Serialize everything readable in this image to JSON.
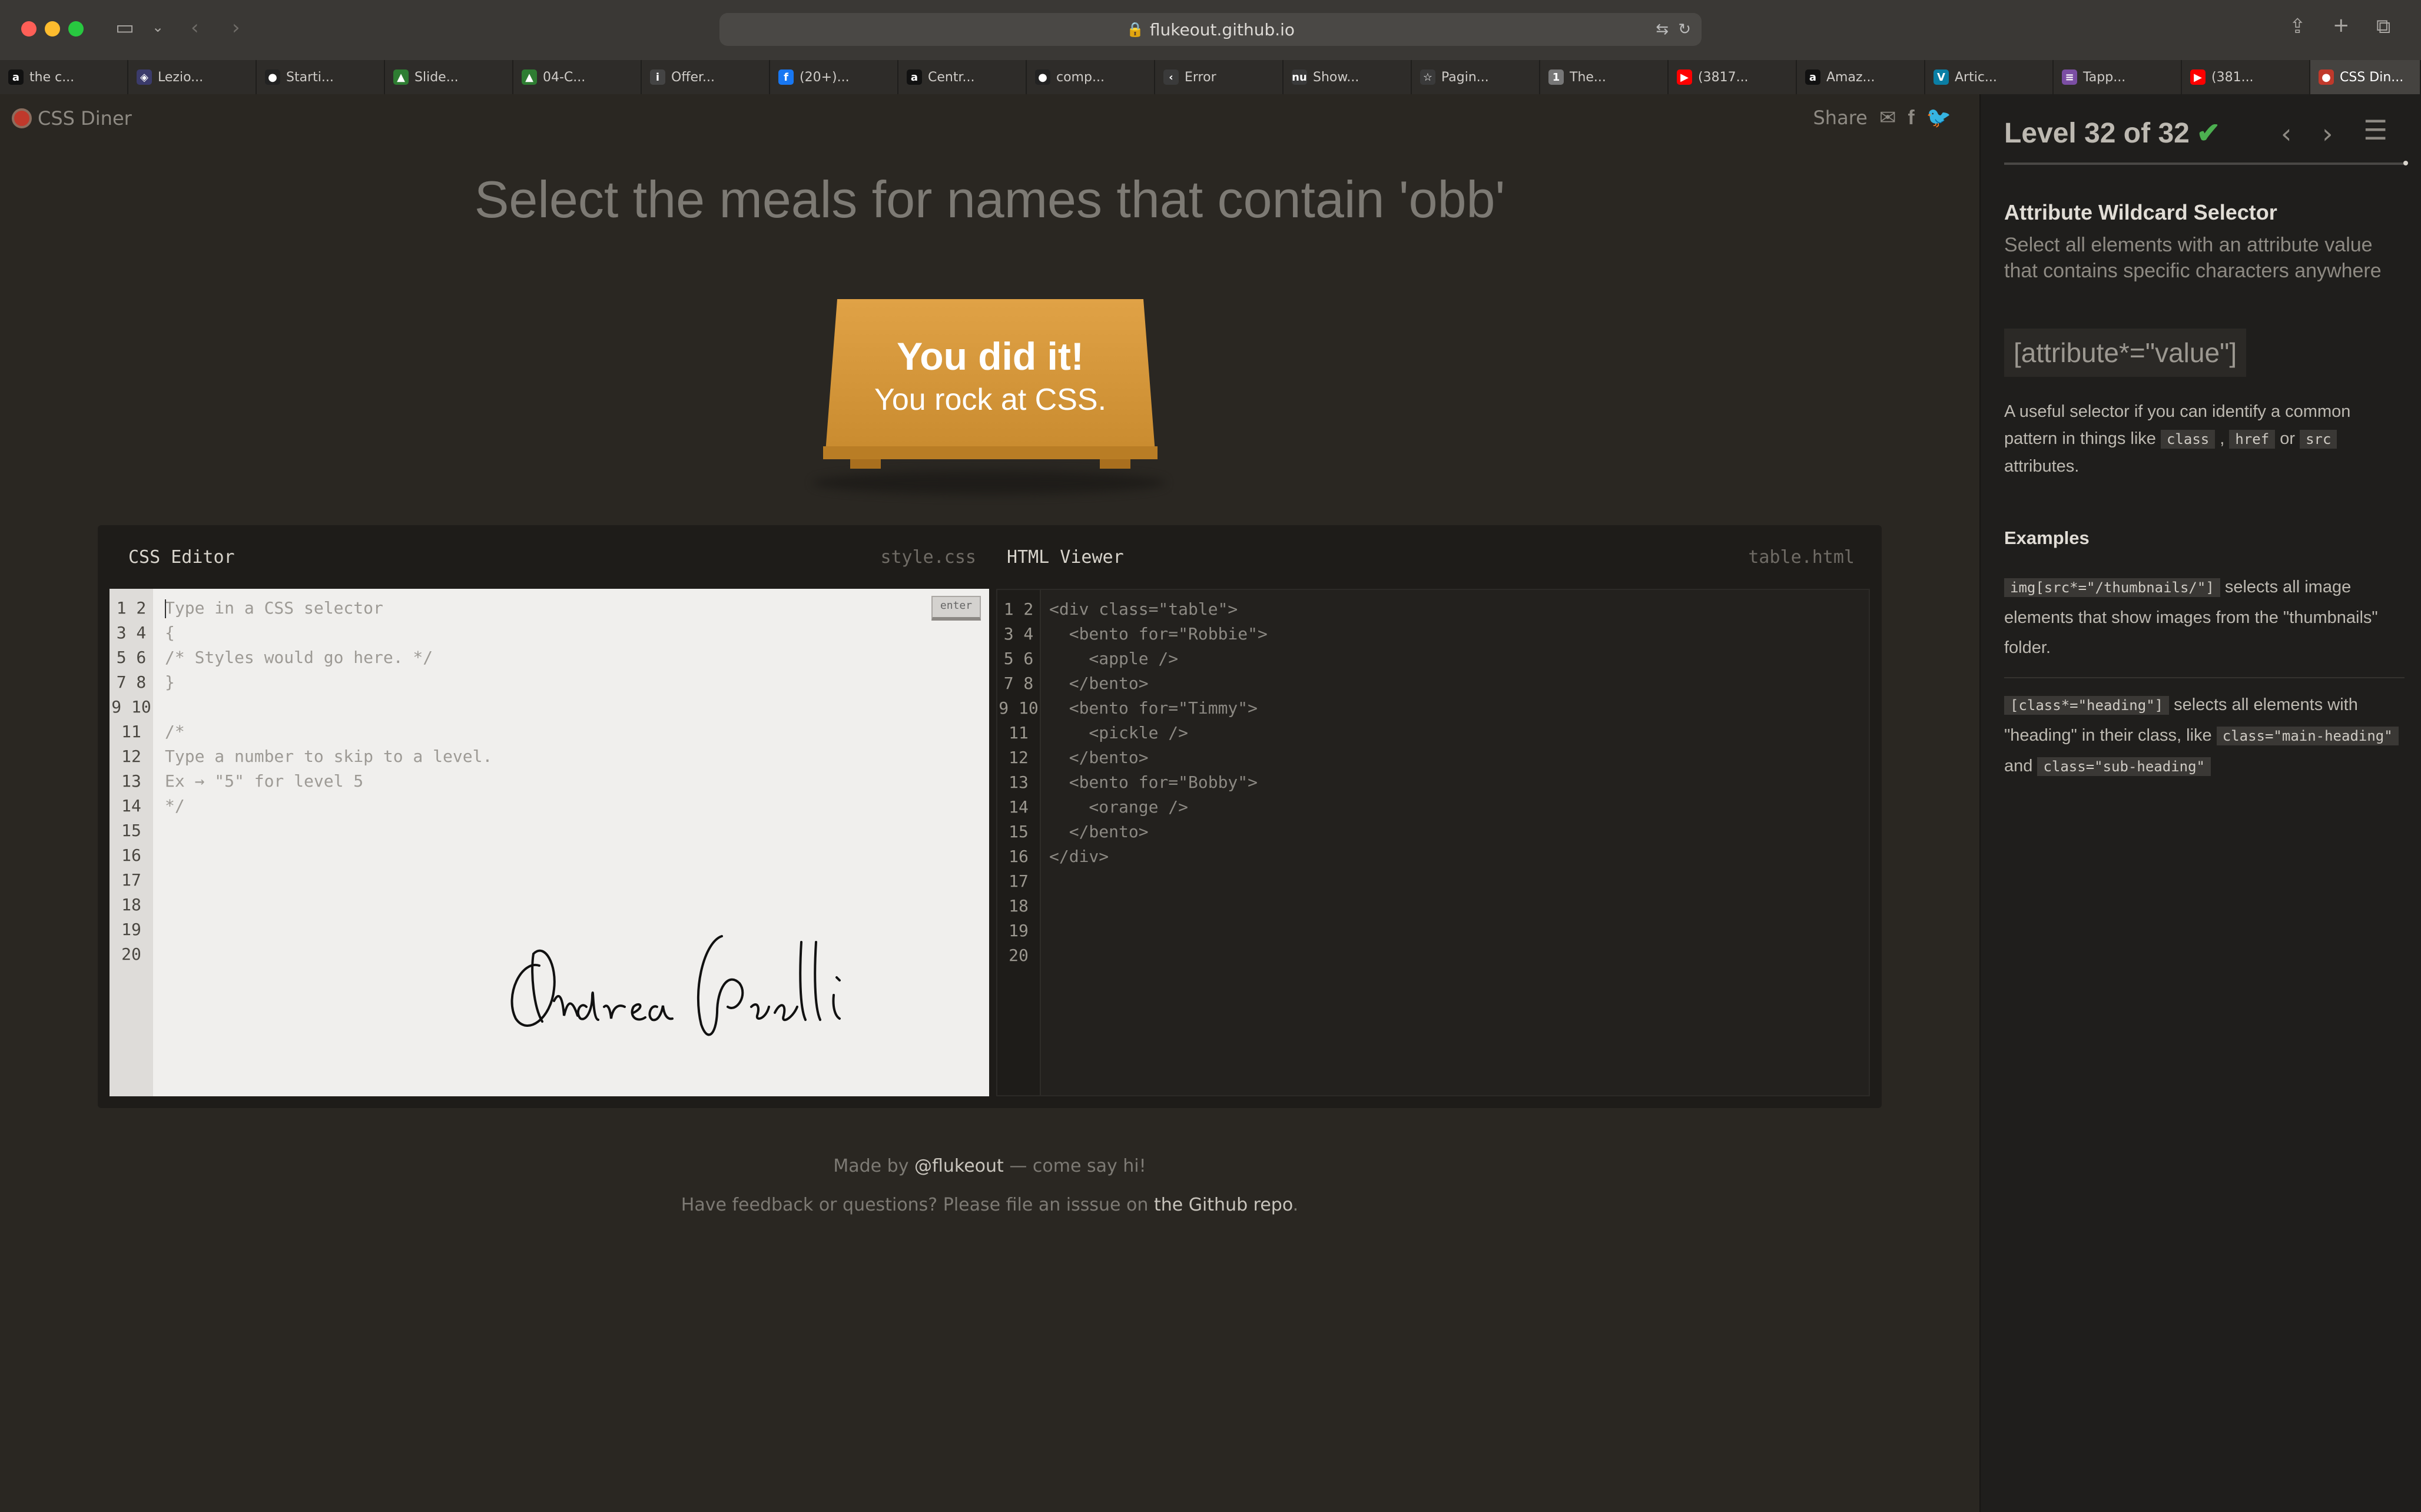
{
  "browser": {
    "url": "flukeout.github.io",
    "tabs": [
      {
        "label": "the c...",
        "icon": "amazon-icon"
      },
      {
        "label": "Lezio...",
        "icon": "notion-icon"
      },
      {
        "label": "Starti...",
        "icon": "github-icon"
      },
      {
        "label": "Slide...",
        "icon": "drive-icon"
      },
      {
        "label": "04-C...",
        "icon": "drive-icon"
      },
      {
        "label": "Offer...",
        "icon": "info-icon"
      },
      {
        "label": "(20+)...",
        "icon": "facebook-icon"
      },
      {
        "label": "Centr...",
        "icon": "amazon-icon"
      },
      {
        "label": "comp...",
        "icon": "github-icon"
      },
      {
        "label": "Error",
        "icon": "code-icon"
      },
      {
        "label": "Show...",
        "icon": "nu-icon"
      },
      {
        "label": "Pagin...",
        "icon": "star-icon"
      },
      {
        "label": "The...",
        "icon": "one-icon"
      },
      {
        "label": "(3817...",
        "icon": "youtube-icon"
      },
      {
        "label": "Amaz...",
        "icon": "amazon-icon"
      },
      {
        "label": "Artic...",
        "icon": "v-icon"
      },
      {
        "label": "Tapp...",
        "icon": "stripes-icon"
      },
      {
        "label": "(381...",
        "icon": "youtube-icon"
      },
      {
        "label": "CSS Din...",
        "icon": "cssdiner-icon"
      }
    ],
    "tab_icon_glyphs": [
      "a",
      "◈",
      "●",
      "▲",
      "▲",
      "i",
      "f",
      "a",
      "●",
      "‹",
      "nu",
      "☆",
      "1",
      "▶",
      "a",
      "V",
      "≡",
      "▶",
      "●"
    ],
    "tab_icon_colors": [
      "#111111",
      "#3b3b6b",
      "#222222",
      "#2e7d32",
      "#2e7d32",
      "#444444",
      "#1877f2",
      "#111111",
      "#222222",
      "#3a3a3a",
      "#3a3a3a",
      "#3a3a3a",
      "#777777",
      "#ff0000",
      "#111111",
      "#0a7ea4",
      "#7b4ea3",
      "#ff0000",
      "#c0392b"
    ]
  },
  "header": {
    "logo_text": "CSS Diner",
    "share_label": "Share"
  },
  "game": {
    "instruction": "Select the meals for names that contain 'obb'",
    "win_line1": "You did it!",
    "win_line2": "You rock at CSS."
  },
  "editor": {
    "css_title": "CSS Editor",
    "css_file": "style.css",
    "html_title": "HTML Viewer",
    "html_file": "table.html",
    "enter_label": "enter",
    "line_numbers": "1\n2\n3\n4\n5\n6\n7\n8\n9\n10\n11\n12\n13\n14\n15\n16\n17\n18\n19\n20",
    "css_code": "Type in a CSS selector\n{\n/* Styles would go here. */\n}\n\n/*\nType a number to skip to a level.\nEx → \"5\" for level 5\n*/",
    "html_code": "<div class=\"table\">\n  <bento for=\"Robbie\">\n    <apple />\n  </bento>\n  <bento for=\"Timmy\">\n    <pickle />\n  </bento>\n  <bento for=\"Bobby\">\n    <orange />\n  </bento>\n</div>",
    "signature_text": "Andrea Galli"
  },
  "footer": {
    "made_by_prefix": "Made by ",
    "made_by_link": "@flukeout",
    "made_by_suffix": " — come say hi!",
    "feedback_prefix": "Have feedback or questions? Please file an isssue on ",
    "feedback_link": "the Github repo",
    "feedback_suffix": "."
  },
  "sidebar": {
    "level_title": "Level 32 of 32",
    "selector_name": "Attribute Wildcard Selector",
    "selector_title": "Select all elements with an attribute value that contains specific characters anywhere",
    "syntax": "[attribute*=\"value\"]",
    "hint_prefix": "A useful selector if you can identify a common pattern in things like ",
    "hint_tag1": "class",
    "hint_sep1": " , ",
    "hint_tag2": "href",
    "hint_sep2": " or ",
    "hint_tag3": "src",
    "hint_suffix": " attributes.",
    "examples_heading": "Examples",
    "example1_code": "img[src*=\"/thumbnails/\"]",
    "example1_text": " selects all image elements that show images from the \"thumbnails\" folder.",
    "example2_code": "[class*=\"heading\"]",
    "example2_text1": " selects all elements with \"heading\" in their class, like ",
    "example2_code2": "class=\"main-heading\"",
    "example2_text2": " and ",
    "example2_code3": "class=\"sub-heading\""
  },
  "colors": {
    "accent_check": "#4caf50",
    "table_wood": "#e0a246",
    "background": "#2a2722"
  }
}
